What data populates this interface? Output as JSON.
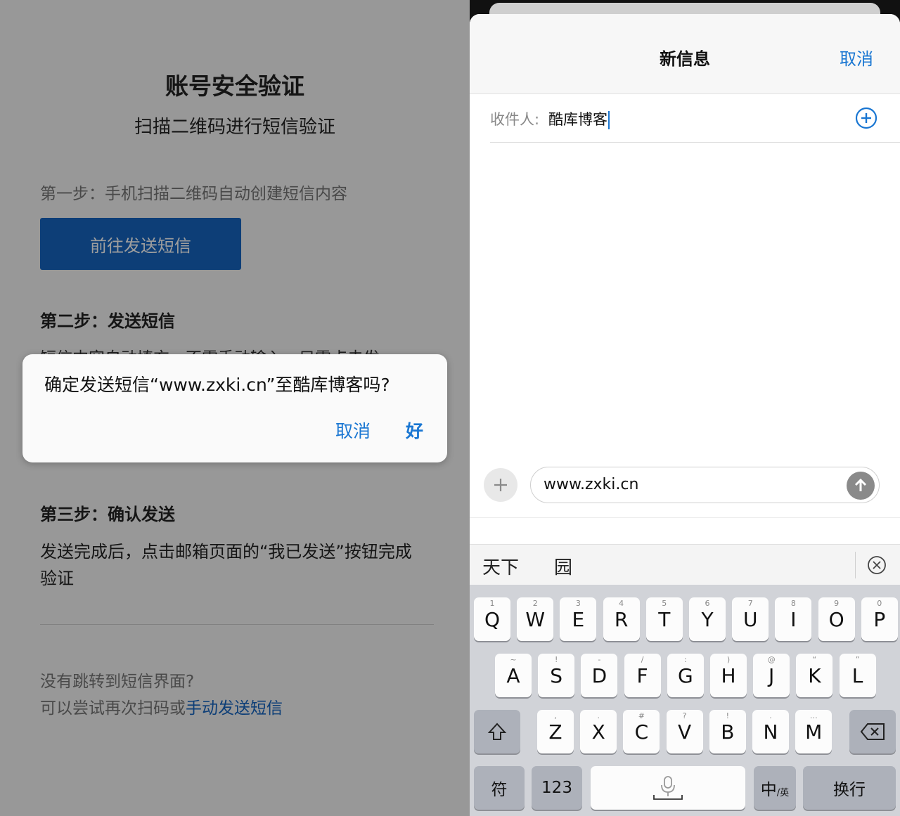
{
  "left": {
    "title": "账号安全验证",
    "subtitle": "扫描二维码进行短信验证",
    "step1_label": "第一步：手机扫描二维码自动创建短信内容",
    "step1_button": "前往发送短信",
    "step2_label": "第二步：发送短信",
    "step2_desc": "短信内容自动填充，不需手动输入，只需点击发",
    "step3_label": "第三步：确认发送",
    "step3_desc": "发送完成后，点击邮箱页面的“我已发送”按钮完成验证",
    "note_line1": "没有跳转到短信界面?",
    "note_line2_prefix": "可以尝试再次扫码或",
    "note_line2_link": "手动发送短信"
  },
  "dialog": {
    "message": "确定发送短信“www.zxki.cn”至酷库博客吗?",
    "cancel": "取消",
    "ok": "好"
  },
  "right": {
    "title": "新信息",
    "cancel": "取消",
    "to_label": "收件人:",
    "to_value": "酷库博客",
    "message_text": "www.zxki.cn",
    "candidates": [
      "天下",
      "园"
    ],
    "keyboard": {
      "row1": [
        {
          "k": "Q",
          "h": "1"
        },
        {
          "k": "W",
          "h": "2"
        },
        {
          "k": "E",
          "h": "3"
        },
        {
          "k": "R",
          "h": "4"
        },
        {
          "k": "T",
          "h": "5"
        },
        {
          "k": "Y",
          "h": "6"
        },
        {
          "k": "U",
          "h": "7"
        },
        {
          "k": "I",
          "h": "8"
        },
        {
          "k": "O",
          "h": "9"
        },
        {
          "k": "P",
          "h": "0"
        }
      ],
      "row2": [
        {
          "k": "A",
          "h": "~"
        },
        {
          "k": "S",
          "h": "!"
        },
        {
          "k": "D",
          "h": "-"
        },
        {
          "k": "F",
          "h": "/"
        },
        {
          "k": "G",
          "h": ":"
        },
        {
          "k": "H",
          "h": ")"
        },
        {
          "k": "J",
          "h": "@"
        },
        {
          "k": "K",
          "h": "“"
        },
        {
          "k": "L",
          "h": "”"
        }
      ],
      "row3": [
        {
          "k": "Z",
          "h": ","
        },
        {
          "k": "X",
          "h": "."
        },
        {
          "k": "C",
          "h": "#"
        },
        {
          "k": "V",
          "h": "?"
        },
        {
          "k": "B",
          "h": "!"
        },
        {
          "k": "N",
          "h": "."
        },
        {
          "k": "M",
          "h": "…"
        }
      ],
      "symbol_key": "符",
      "number_key": "123",
      "lang_key_main": "中",
      "lang_key_sub": "/英",
      "return_key": "换行"
    }
  },
  "colors": {
    "accent": "#1976d2",
    "button_blue": "#1565c0",
    "keyboard_bg": "#d1d3d8"
  }
}
